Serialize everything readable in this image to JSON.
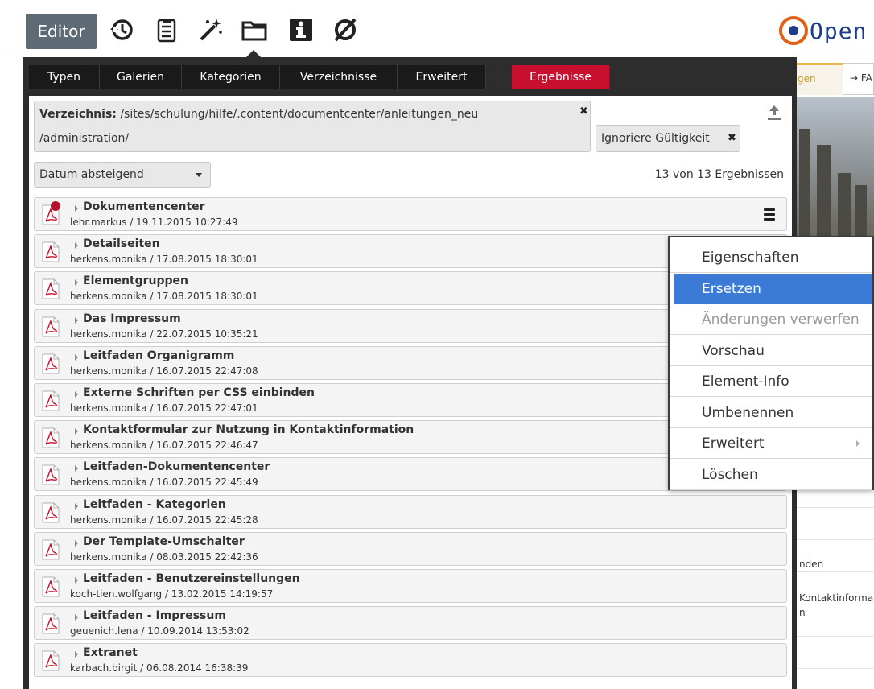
{
  "toolbar": {
    "editor_label": "Editor",
    "icons": [
      "history-icon",
      "clipboard-icon",
      "magic-wand-icon",
      "folder-icon",
      "info-icon",
      "visibility-off-icon"
    ]
  },
  "logo": {
    "text": "Open"
  },
  "background_site": {
    "tab1": "gen",
    "tab2": "→ FA",
    "snippets": [
      "nden",
      "Kontaktinforma",
      "n"
    ]
  },
  "dialog": {
    "tabs": [
      "Typen",
      "Galerien",
      "Kategorien",
      "Verzeichnisse",
      "Erweitert",
      "Ergebnisse"
    ],
    "active_tab": "Ergebnisse",
    "path_label": "Verzeichnis:",
    "path_value": "/sites/schulung/hilfe/.content/documentcenter/anleitungen_neu",
    "path_value2": "/administration/",
    "ignore_label": "Ignoriere Gültigkeit",
    "close_glyph": "✖",
    "sort": {
      "selected": "Datum absteigend"
    },
    "result_count": "13 von 13 Ergebnissen",
    "results": [
      {
        "title": "Dokumentencenter",
        "meta": "lehr.markus / 19.11.2015 10:27:49",
        "changed": true
      },
      {
        "title": "Detailseiten",
        "meta": "herkens.monika / 17.08.2015 18:30:01"
      },
      {
        "title": "Elementgruppen",
        "meta": "herkens.monika / 17.08.2015 18:30:01"
      },
      {
        "title": "Das Impressum",
        "meta": "herkens.monika / 22.07.2015 10:35:21"
      },
      {
        "title": "Leitfaden Organigramm",
        "meta": "herkens.monika / 16.07.2015 22:47:08"
      },
      {
        "title": "Externe Schriften per CSS einbinden",
        "meta": "herkens.monika / 16.07.2015 22:47:01"
      },
      {
        "title": "Kontaktformular zur Nutzung in Kontaktinformation",
        "meta": "herkens.monika / 16.07.2015 22:46:47"
      },
      {
        "title": "Leitfaden-Dokumentencenter",
        "meta": "herkens.monika / 16.07.2015 22:45:49"
      },
      {
        "title": "Leitfaden - Kategorien",
        "meta": "herkens.monika / 16.07.2015 22:45:28"
      },
      {
        "title": "Der Template-Umschalter",
        "meta": "herkens.monika / 08.03.2015 22:42:36"
      },
      {
        "title": "Leitfaden - Benutzereinstellungen",
        "meta": "koch-tien.wolfgang / 13.02.2015 14:19:57"
      },
      {
        "title": "Leitfaden - Impressum",
        "meta": "geuenich.lena / 10.09.2014 13:53:02"
      },
      {
        "title": "Extranet",
        "meta": "karbach.birgit / 06.08.2014 16:38:39"
      }
    ]
  },
  "context_menu": {
    "items": [
      {
        "label": "Eigenschaften",
        "state": "normal"
      },
      {
        "label": "Ersetzen",
        "state": "active"
      },
      {
        "label": "Änderungen verwerfen",
        "state": "disabled"
      },
      {
        "label": "Vorschau",
        "state": "normal"
      },
      {
        "label": "Element-Info",
        "state": "normal"
      },
      {
        "label": "Umbenennen",
        "state": "normal"
      },
      {
        "label": "Erweitert",
        "state": "normal",
        "submenu": true
      },
      {
        "label": "Löschen",
        "state": "normal"
      }
    ],
    "active_color": "#3b7bd5"
  },
  "colors": {
    "active_tab": "#c8102e",
    "dialog_bg": "#2d2d2d",
    "editor_button": "#5f6b74"
  }
}
